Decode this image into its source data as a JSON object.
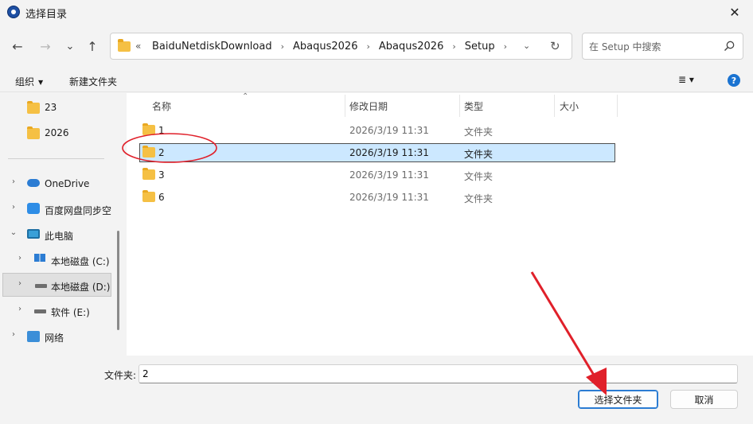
{
  "window": {
    "title": "选择目录",
    "close_glyph": "✕"
  },
  "nav": {
    "back_glyph": "←",
    "forward_glyph": "→",
    "recent_glyph": "⌄",
    "up_glyph": "↑",
    "overflow_glyph": "«",
    "breadcrumbs": [
      "BaiduNetdiskDownload",
      "Abaqus2026",
      "Abaqus2026",
      "Setup"
    ],
    "crumb_sep": "›",
    "dropdown_glyph": "⌄",
    "refresh_glyph": "↻"
  },
  "search": {
    "placeholder": "在 Setup 中搜索"
  },
  "toolbar": {
    "organize_label": "组织",
    "new_folder_label": "新建文件夹",
    "caret": "▼",
    "view_glyph": "≣ ▾",
    "help_glyph": "?"
  },
  "sidebar": {
    "items": [
      {
        "label": "23",
        "icon": "folder-icon",
        "expander": ""
      },
      {
        "label": "2026",
        "icon": "folder-icon",
        "expander": ""
      },
      {
        "label": "OneDrive",
        "icon": "onedrive-cloud-icon",
        "expander": "›"
      },
      {
        "label": "百度网盘同步空",
        "icon": "baidu-sync-icon",
        "expander": "›"
      },
      {
        "label": "此电脑",
        "icon": "this-pc-icon",
        "expander": "⌄"
      },
      {
        "label": "本地磁盘 (C:)",
        "icon": "windows-drive-icon",
        "expander": "›"
      },
      {
        "label": "本地磁盘 (D:)",
        "icon": "drive-icon",
        "expander": "›"
      },
      {
        "label": "软件 (E:)",
        "icon": "drive-icon",
        "expander": "›"
      },
      {
        "label": "网络",
        "icon": "network-icon",
        "expander": "›"
      }
    ]
  },
  "columns": {
    "name": "名称",
    "date": "修改日期",
    "type": "类型",
    "size": "大小",
    "sort_glyph": "⌃"
  },
  "files": [
    {
      "name": "1",
      "date": "2026/3/19 11:31",
      "type": "文件夹"
    },
    {
      "name": "2",
      "date": "2026/3/19 11:31",
      "type": "文件夹"
    },
    {
      "name": "3",
      "date": "2026/3/19 11:31",
      "type": "文件夹"
    },
    {
      "name": "6",
      "date": "2026/3/19 11:31",
      "type": "文件夹"
    }
  ],
  "footer": {
    "folder_label": "文件夹:",
    "folder_value": "2",
    "select_button": "选择文件夹",
    "cancel_button": "取消"
  },
  "colors": {
    "selection": "#cce8ff",
    "annotation": "#e0202a",
    "accent": "#2b7cd3"
  }
}
